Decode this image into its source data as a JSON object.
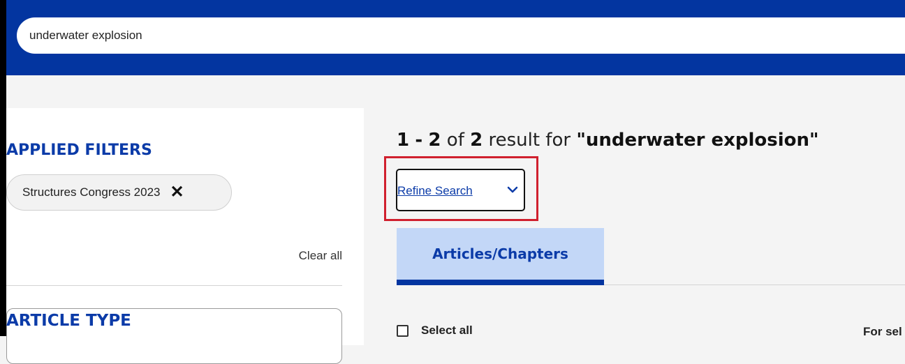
{
  "search": {
    "value": "underwater explosion"
  },
  "filters": {
    "title": "APPLIED FILTERS",
    "chips": [
      {
        "label": "Structures Congress 2023"
      }
    ],
    "clear_all": "Clear all"
  },
  "article_type": {
    "title": "ARTICLE TYPE"
  },
  "results": {
    "range_start": "1",
    "range_end": "2",
    "of_text": "of",
    "total": "2",
    "result_text": "result for",
    "query": "\"underwater explosion\""
  },
  "refine": {
    "label": "Refine Search",
    "icon": "chevron-down-icon"
  },
  "tabs": [
    {
      "label": "Articles/Chapters",
      "active": true
    }
  ],
  "list": {
    "select_all": "Select all",
    "for_selected": "For sel"
  },
  "colors": {
    "header": "#0335a0",
    "accent": "#0b3ba8",
    "highlight": "#d0202e",
    "tab_active": "#c3d7f7"
  }
}
